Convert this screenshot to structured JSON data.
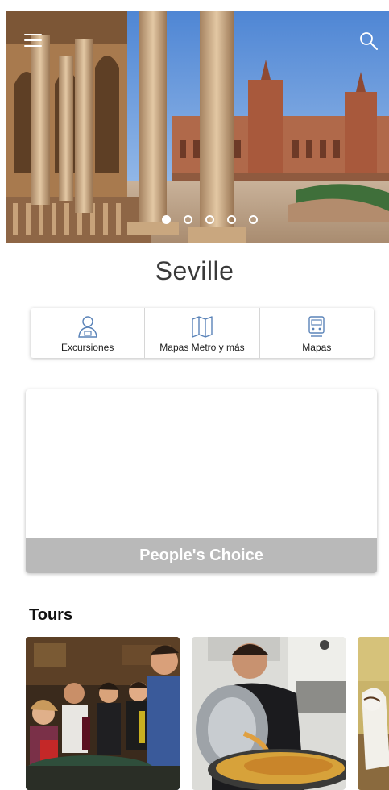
{
  "hero": {
    "slides": [
      {
        "name": "slide-1",
        "active": true
      },
      {
        "name": "slide-2",
        "active": false
      },
      {
        "name": "slide-3",
        "active": false
      },
      {
        "name": "slide-4",
        "active": false
      },
      {
        "name": "slide-5",
        "active": false
      }
    ],
    "menu_icon": "hamburger-menu-icon",
    "search_icon": "search-icon"
  },
  "city": {
    "title": "Seville"
  },
  "actions": [
    {
      "label": "Excursiones",
      "icon": "tour-guide-icon"
    },
    {
      "label": "Mapas Metro y más",
      "icon": "map-icon"
    },
    {
      "label": "Mapas",
      "icon": "metro-train-icon"
    }
  ],
  "choice": {
    "label": "People's Choice"
  },
  "tours": {
    "heading": "Tours"
  },
  "colors": {
    "icon_blue": "#5a83b8",
    "banner_gray": "#b9b9b9"
  }
}
